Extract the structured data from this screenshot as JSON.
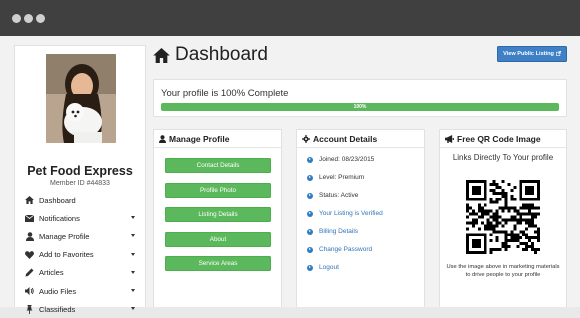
{
  "sidebar": {
    "name": "Pet Food Express",
    "member_id": "Member ID #44833",
    "nav": [
      {
        "label": "Dashboard",
        "icon": "home-icon",
        "caret": false
      },
      {
        "label": "Notifications",
        "icon": "envelope-icon",
        "caret": true
      },
      {
        "label": "Manage Profile",
        "icon": "user-icon",
        "caret": true
      },
      {
        "label": "Add to Favorites",
        "icon": "heart-icon",
        "caret": true
      },
      {
        "label": "Articles",
        "icon": "pencil-icon",
        "caret": true
      },
      {
        "label": "Audio Files",
        "icon": "volume-icon",
        "caret": true
      },
      {
        "label": "Classifieds",
        "icon": "thumbtack-icon",
        "caret": true
      }
    ]
  },
  "header": {
    "title": "Dashboard",
    "public_listing_label": "View Public Listing"
  },
  "progress": {
    "text": "Your profile is 100% Complete",
    "bar_label": "100%",
    "fraction": 1.0
  },
  "manage_profile": {
    "title": "Manage Profile",
    "buttons": [
      "Contact Details",
      "Profile Photo",
      "Listing Details",
      "About",
      "Service Areas"
    ]
  },
  "account_details": {
    "title": "Account Details",
    "items": [
      {
        "text": "Joined: 08/23/2015",
        "link": false
      },
      {
        "text": "Level: Premium",
        "link": false
      },
      {
        "text": "Status: Active",
        "link": false
      },
      {
        "text": "Your Listing is Verified",
        "link": true
      },
      {
        "text": "Billing Details",
        "link": true
      },
      {
        "text": "Change Password",
        "link": true
      },
      {
        "text": "Logout",
        "link": true
      }
    ]
  },
  "qr": {
    "title": "Free QR Code Image",
    "subtitle": "Links Directly To Your profile",
    "description": "Use the image above in marketing materials to drive people to your profile"
  },
  "colors": {
    "chrome": "#404040",
    "green": "#5cb85c",
    "blue_button": "#3f80c6",
    "link": "#2f74b8"
  }
}
